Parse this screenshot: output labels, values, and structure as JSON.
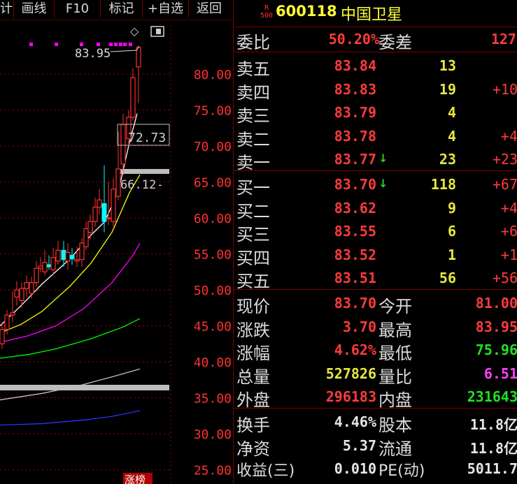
{
  "toolbar": [
    "计",
    "画线",
    "F10",
    "标记",
    "+自选",
    "返回"
  ],
  "chart": {
    "y_ticks": [
      "80.00",
      "75.00",
      "70.00",
      "65.00",
      "60.00",
      "55.00",
      "50.00",
      "45.00",
      "40.00",
      "35.00",
      "30.00",
      "25.00"
    ],
    "annotations": {
      "high": "83.95",
      "mid": "72.73",
      "low": "66.12"
    },
    "bottom_tag": "涨榜",
    "colors": {
      "up": "#ff3030",
      "down": "#00ffff",
      "ma5": "#ffffff",
      "ma10": "#ffff00",
      "ma20": "#ff00ff",
      "ma60": "#00ff00",
      "ma120": "#c0c0c0",
      "ma250": "#3030ff"
    }
  },
  "header": {
    "badge_top": "R",
    "badge_bottom": "500",
    "code": "600118",
    "name": "中国卫星"
  },
  "weibi": {
    "label": "委比",
    "value": "50.20%",
    "label2": "委差",
    "value2": "127"
  },
  "asks": [
    {
      "label": "卖五",
      "price": "83.84",
      "vol": "13",
      "chg": ""
    },
    {
      "label": "卖四",
      "price": "83.83",
      "vol": "19",
      "chg": "+10"
    },
    {
      "label": "卖三",
      "price": "83.79",
      "vol": "4",
      "chg": ""
    },
    {
      "label": "卖二",
      "price": "83.78",
      "vol": "4",
      "chg": "+4"
    },
    {
      "label": "卖一",
      "price": "83.77",
      "vol": "23",
      "chg": "+23",
      "arrow": "↓"
    }
  ],
  "bids": [
    {
      "label": "买一",
      "price": "83.70",
      "vol": "118",
      "chg": "+67",
      "arrow": "↓"
    },
    {
      "label": "买二",
      "price": "83.62",
      "vol": "9",
      "chg": "+4"
    },
    {
      "label": "买三",
      "price": "83.55",
      "vol": "6",
      "chg": "+6"
    },
    {
      "label": "买四",
      "price": "83.52",
      "vol": "1",
      "chg": "+1"
    },
    {
      "label": "买五",
      "price": "83.51",
      "vol": "56",
      "chg": "+56"
    }
  ],
  "stats": [
    {
      "l1": "现价",
      "v1": "83.70",
      "c1": "red",
      "l2": "今开",
      "v2": "81.00",
      "c2": "red"
    },
    {
      "l1": "涨跌",
      "v1": "3.70",
      "c1": "red",
      "l2": "最高",
      "v2": "83.95",
      "c2": "red"
    },
    {
      "l1": "涨幅",
      "v1": "4.62%",
      "c1": "red",
      "l2": "最低",
      "v2": "75.96",
      "c2": "grn"
    },
    {
      "l1": "总量",
      "v1": "527826",
      "c1": "yel",
      "l2": "量比",
      "v2": "6.51",
      "c2": "mag"
    },
    {
      "l1": "外盘",
      "v1": "296183",
      "c1": "red",
      "l2": "内盘",
      "v2": "231643",
      "c2": "grn"
    }
  ],
  "stats2": [
    {
      "l1": "换手",
      "v1": "4.46%",
      "l2": "股本",
      "v2": "11.8亿"
    },
    {
      "l1": "净资",
      "v1": "5.37",
      "l2": "流通",
      "v2": "11.8亿"
    },
    {
      "l1": "收益(三)",
      "v1": "0.010",
      "l2": "PE(动)",
      "v2": "5011.7"
    }
  ]
}
